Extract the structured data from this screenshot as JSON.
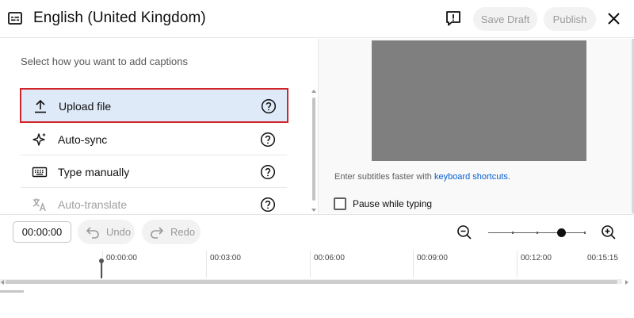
{
  "header": {
    "title": "English (United Kingdom)",
    "save_draft_label": "Save Draft",
    "publish_label": "Publish"
  },
  "captions": {
    "prompt": "Select how you want to add captions",
    "options": [
      {
        "label": "Upload file",
        "icon": "upload-icon",
        "selected": true
      },
      {
        "label": "Auto-sync",
        "icon": "sparkle-icon"
      },
      {
        "label": "Type manually",
        "icon": "keyboard-icon"
      },
      {
        "label": "Auto-translate",
        "icon": "translate-icon",
        "disabled": true
      }
    ]
  },
  "preview": {
    "hint_text": "Enter subtitles faster with ",
    "hint_link": "keyboard shortcuts",
    "hint_end": ".",
    "pause_label": "Pause while typing",
    "pause_checked": false
  },
  "toolbar": {
    "time_value": "00:00:00",
    "undo_label": "Undo",
    "redo_label": "Redo",
    "zoom_level": 0.75
  },
  "timeline": {
    "labels": [
      "00:00:00",
      "00:03:00",
      "00:06:00",
      "00:09:00",
      "00:12:00",
      "00:15:15"
    ]
  },
  "colors": {
    "selected_bg": "#dfeaf8",
    "highlight_border": "#d3242a",
    "link": "#065fd4",
    "video_placeholder": "#7f7f7f"
  }
}
